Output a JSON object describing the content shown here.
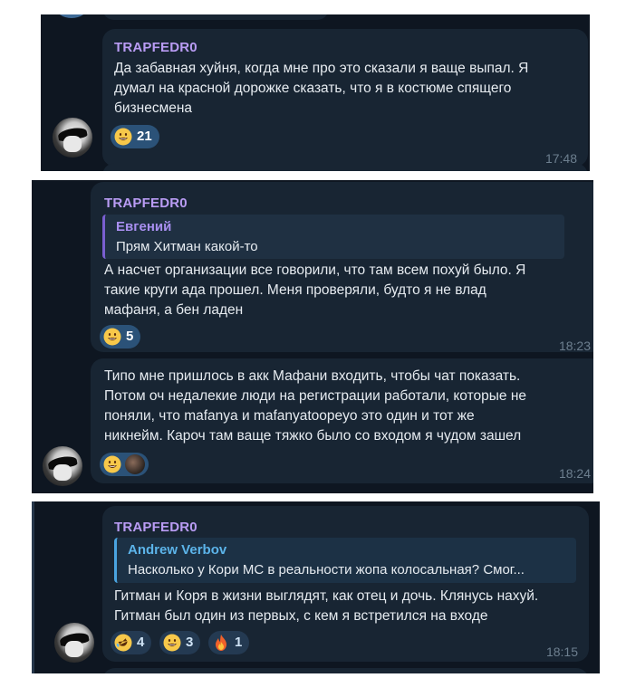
{
  "panels": [
    {
      "sender": "TRAPFEDR0",
      "lines": [
        "Да забавная хуйня, когда мне про это сказали я ваще выпал. Я",
        "думал на красной дорожке сказать, что я в костюме спящего",
        "бизнесмена"
      ],
      "reaction": {
        "emoji": "grinning-face-icon",
        "count": "21"
      },
      "time": "17:48"
    },
    {
      "sender": "TRAPFEDR0",
      "quote": {
        "name": "Евгений",
        "text": "Прям Хитман какой-то"
      },
      "lines": [
        "А насчет организации все говорили, что там всем похуй было. Я",
        "такие круги ада прошел. Меня проверяли, будто я не влад",
        "мафаня, а бен ладен"
      ],
      "reaction": {
        "emoji": "grinning-face-icon",
        "count": "5"
      },
      "time": "18:23"
    },
    {
      "lines": [
        "Типо мне пришлось в акк Мафани входить, чтобы чат показать.",
        "Потом оч недалекие люди на регистрации работали, которые не",
        "поняли, что mafanya и mafanyatoopeyo это один и тот же",
        "никнейм. Кароч там ваще тяжко было со входом я чудом зашел"
      ],
      "reaction": {
        "emoji": "grinning-face-icon"
      },
      "time": "18:24"
    },
    {
      "sender": "TRAPFEDR0",
      "quote": {
        "name": "Andrew Verbov",
        "text": "Насколько у Кори МС в реальности жопа колосальная? Смог..."
      },
      "lines": [
        "Гитман и Коря в жизни выглядят, как отец и дочь. Клянусь нахуй.",
        "Гитман был один из первых, с кем я встретился на входе"
      ],
      "reactions": [
        {
          "emoji": "rofl-face-icon",
          "count": "4"
        },
        {
          "emoji": "grinning-face-icon",
          "count": "3"
        },
        {
          "emoji": "fire-icon",
          "count": "1"
        }
      ],
      "time": "18:15"
    }
  ],
  "colors": {
    "background": "#0e1621",
    "bubble": "#182533",
    "sender": "#b99cf4",
    "reaction": "#2b5278",
    "time": "#6d7f8f"
  }
}
